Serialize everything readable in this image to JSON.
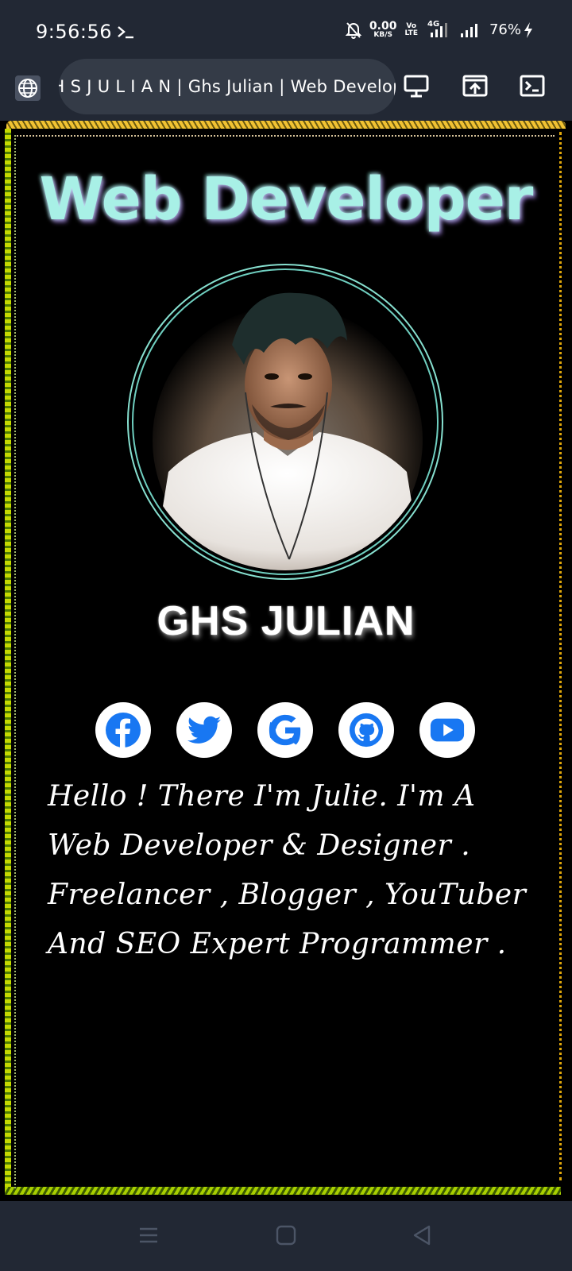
{
  "status_bar": {
    "time": "9:56:56",
    "net_speed_value": "0.00",
    "net_speed_unit": "KB/S",
    "volte_top": "Vo",
    "volte_bottom": "LTE",
    "network_type": "4G",
    "battery": "76%"
  },
  "browser": {
    "url_title": "G H S J U L I A N | Ghs Julian | Web Developer"
  },
  "page": {
    "title": "Web Developer",
    "name": "GHS  JULIAN",
    "bio": "Hello ! There I'm Julie. I'm A Web Developer & Designer . Freelancer , Blogger , YouTuber And SEO Expert Programmer .",
    "socials": [
      {
        "icon": "facebook-icon"
      },
      {
        "icon": "twitter-icon"
      },
      {
        "icon": "google-icon"
      },
      {
        "icon": "github-icon"
      },
      {
        "icon": "youtube-icon"
      }
    ]
  },
  "colors": {
    "accent_blue": "#1877f2",
    "title_color": "#a8f0e6",
    "bar_bg": "#222834"
  }
}
